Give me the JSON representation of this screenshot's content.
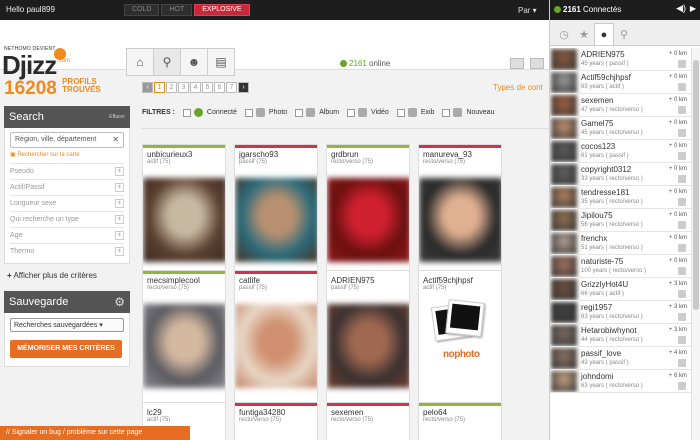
{
  "topbar": {
    "greeting": "Hello paul899",
    "modes": [
      {
        "label": "COLD",
        "active": false
      },
      {
        "label": "HOT",
        "active": false
      },
      {
        "label": "EXPLOSIVE",
        "active": true
      }
    ],
    "par_text": "Par"
  },
  "header": {
    "logo_tagline": "NETHOMO DEVIENT",
    "logo_text": "Djizz",
    "logo_suffix": ".com",
    "online_count": "2161",
    "online_label": "online"
  },
  "left": {
    "profile_count": "16208",
    "profile_label1": "PROFILS",
    "profile_label2": "TROUVÉS",
    "search_title": "Search",
    "search_clear": "Effacer",
    "search_placeholder": "Région, ville, département",
    "map_link": "Rechercher sur la carte",
    "criteria": [
      "Pseudo",
      "Actif/Passif",
      "Longueur sexe",
      "Qui recherche un type",
      "Age",
      "Thermo"
    ],
    "more_criteria": "Afficher plus de critères",
    "save_title": "Sauvegarde",
    "saved_select": "Recherches sauvegardées",
    "memorize_button": "MÉMORISER MES CRITÈRES"
  },
  "pager": {
    "pages": [
      "1",
      "2",
      "3",
      "4",
      "5",
      "6",
      "7"
    ],
    "current": "1"
  },
  "types_link": "Types de cont",
  "filters": {
    "label": "FILTRES :",
    "options": [
      "Connecté",
      "Photo",
      "Album",
      "Vidéo",
      "Exib",
      "Nouveau"
    ]
  },
  "cards": [
    {
      "name": "unbicurieux3",
      "desc": "actif (75)",
      "bar": "green",
      "colors": [
        "#5a4030",
        "#c8b8a0",
        "#3a2a22"
      ]
    },
    {
      "name": "jgarscho93",
      "desc": "passif (75)",
      "bar": "red",
      "colors": [
        "#2a6a7a",
        "#b89070",
        "#4a3020"
      ]
    },
    {
      "name": "grdbrun",
      "desc": "recto/verso (75)",
      "bar": "green",
      "colors": [
        "#6a1010",
        "#d02030",
        "#901818"
      ]
    },
    {
      "name": "manureva_93",
      "desc": "recto/verso (75)",
      "bar": "red",
      "colors": [
        "#2a2a2a",
        "#e0b090",
        "#3a3a3a"
      ]
    },
    {
      "name": "mecsimplecool",
      "desc": "recto/verso (75)",
      "bar": "green",
      "colors": [
        "#5a5a60",
        "#d4b8a0",
        "#8a8a90"
      ]
    },
    {
      "name": "catlife",
      "desc": "passif (75)",
      "bar": "red",
      "colors": [
        "#e8d8c8",
        "#d09070",
        "#c08060"
      ]
    },
    {
      "name": "ADRIEN975",
      "desc": "passif (75)",
      "bar": "none",
      "colors": [
        "#3a3030",
        "#a06850",
        "#704030"
      ]
    },
    {
      "name": "Actif59chjhpsf",
      "desc": "actif (75)",
      "bar": "none",
      "nophoto": true
    },
    {
      "name": "lc29",
      "desc": "actif (75)",
      "bar": "none",
      "colors": [
        "#ccc",
        "#ddd",
        "#bbb"
      ]
    },
    {
      "name": "funtiga34280",
      "desc": "recto/verso (75)",
      "bar": "red",
      "colors": [
        "#ccc",
        "#ddd",
        "#bbb"
      ]
    },
    {
      "name": "sexemen",
      "desc": "recto/verso (75)",
      "bar": "red",
      "colors": [
        "#ccc",
        "#ddd",
        "#bbb"
      ]
    },
    {
      "name": "pelo64",
      "desc": "recto/verso (75)",
      "bar": "green",
      "colors": [
        "#ccc",
        "#ddd",
        "#bbb"
      ]
    }
  ],
  "nophoto_text": "nophoto",
  "bugbar": "// Signaler un bug / problème sur cette page",
  "right_panel": {
    "connected_count": "2161",
    "connected_label": "Connectés",
    "users": [
      {
        "name": "ADRIEN975",
        "sub": "45 years ( passif )",
        "dist": "+ 0 km",
        "color": "#8a5a40"
      },
      {
        "name": "Actif59chjhpsf",
        "sub": "63 years ( actif )",
        "dist": "+ 0 km",
        "color": "#9a9a9a"
      },
      {
        "name": "sexemen",
        "sub": "47 years ( recto/verso )",
        "dist": "+ 0 km",
        "color": "#a06040"
      },
      {
        "name": "Gamel75",
        "sub": "45 years ( recto/verso )",
        "dist": "+ 0 km",
        "color": "#c09070"
      },
      {
        "name": "cocos123",
        "sub": "61 years ( passif )",
        "dist": "+ 0 km",
        "color": "#5a5a5a"
      },
      {
        "name": "copyright0312",
        "sub": "33 years ( recto/verso )",
        "dist": "+ 0 km",
        "color": "#606060"
      },
      {
        "name": "tendresse181",
        "sub": "35 years ( recto/verso )",
        "dist": "+ 0 km",
        "color": "#b08060"
      },
      {
        "name": "Jipilou75",
        "sub": "56 years ( recto/verso )",
        "dist": "+ 0 km",
        "color": "#907050"
      },
      {
        "name": "frenchx",
        "sub": "51 years ( recto/verso )",
        "dist": "+ 0 km",
        "color": "#b0a090"
      },
      {
        "name": "naturiste-75",
        "sub": "100 years ( recto/verso )",
        "dist": "+ 0 km",
        "color": "#a07060"
      },
      {
        "name": "GrizzlyHot4U",
        "sub": "66 years ( actif )",
        "dist": "+ 3 km",
        "color": "#6a5040"
      },
      {
        "name": "regi1957",
        "sub": "63 years ( recto/verso )",
        "dist": "+ 3 km",
        "color": "#404040"
      },
      {
        "name": "Hetarobiwhynot",
        "sub": "44 years ( recto/verso )",
        "dist": "+ 3 km",
        "color": "#7a6a60"
      },
      {
        "name": "passif_love",
        "sub": "43 years ( passif )",
        "dist": "+ 4 km",
        "color": "#8a7060"
      },
      {
        "name": "johndomi",
        "sub": "63 years ( recto/verso )",
        "dist": "+ 6 km",
        "color": "#c0a080"
      }
    ]
  }
}
